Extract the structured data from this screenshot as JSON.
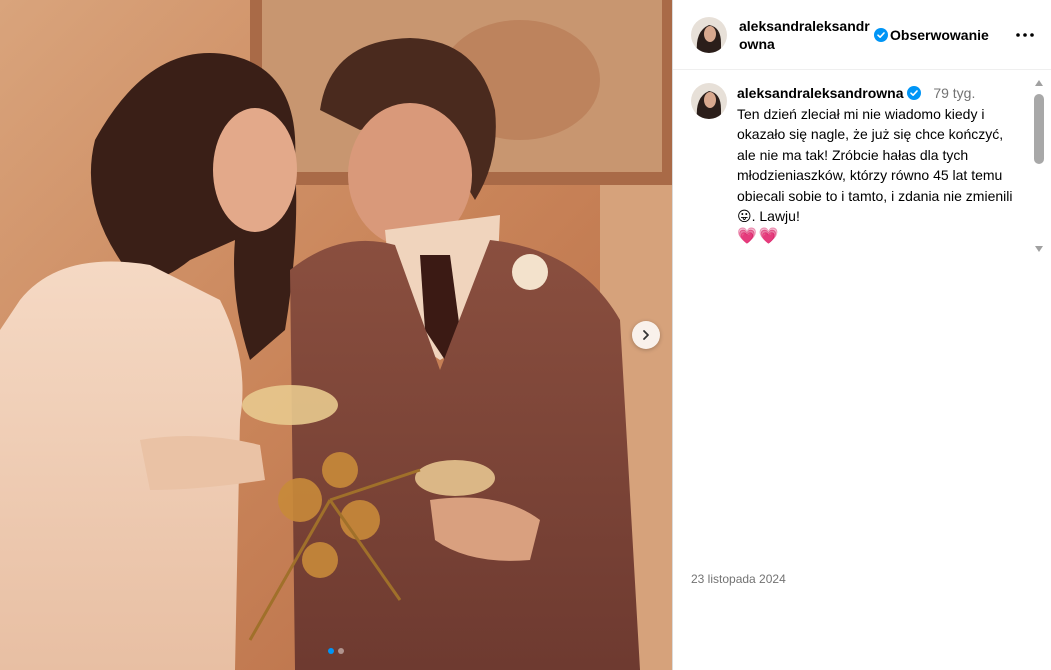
{
  "post": {
    "username": "aleksandraleksandrowna",
    "follow_label": "Obserwowanie",
    "more_icon": "more-horizontal-icon",
    "verified_icon": "verified-badge-icon",
    "date": "23 listopada 2024",
    "carousel": {
      "current": 1,
      "total": 2
    }
  },
  "caption": {
    "username": "aleksandraleksandrowna",
    "time": "79 tyg.",
    "text": "Ten dzień zleciał mi nie wiadomo kiedy i okazało się nagle, że już się chce kończyć, ale nie ma tak! Zróbcie hałas dla tych młodzieniaszków, którzy równo 45 lat temu obiecali sobie to i tamto, i zdania nie zmienili 😛. Lawju!",
    "emoji_line": "💗💗"
  },
  "colors": {
    "verified": "#0095f6",
    "secondary_text": "#737373",
    "photo_tone": "#c98a5e"
  }
}
